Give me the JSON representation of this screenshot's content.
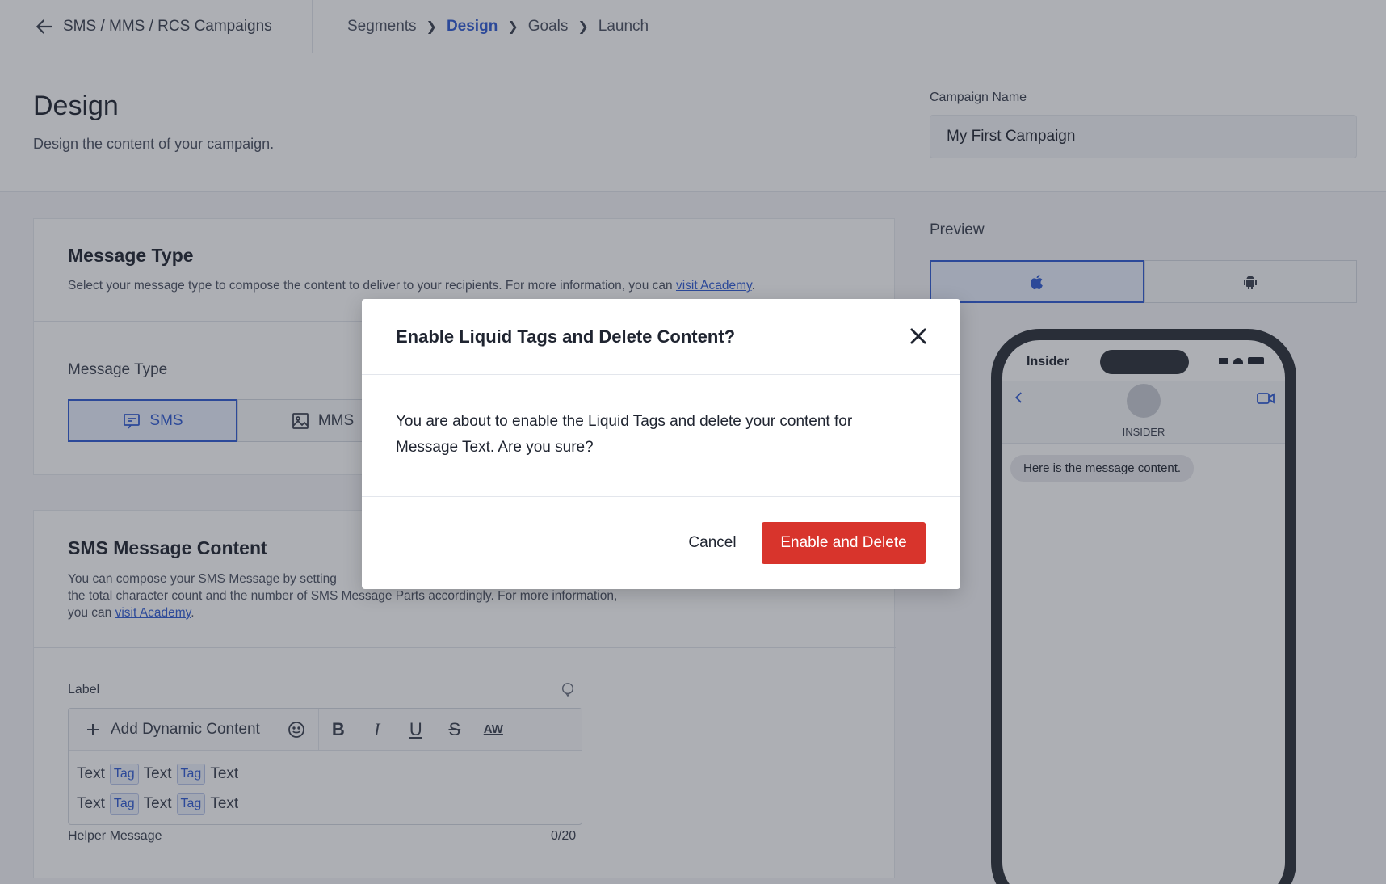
{
  "topbar": {
    "back_label": "SMS / MMS / RCS Campaigns",
    "breadcrumbs": [
      "Segments",
      "Design",
      "Goals",
      "Launch"
    ],
    "active_step": "Design"
  },
  "header": {
    "title": "Design",
    "subtitle": "Design the content of your campaign.",
    "campaign_name_label": "Campaign Name",
    "campaign_name_value": "My First Campaign"
  },
  "message_type_card": {
    "title": "Message Type",
    "desc_prefix": "Select your message type to compose the content to deliver to your recipients. For more information, you can ",
    "desc_link": "visit Academy",
    "desc_suffix": ".",
    "field_label": "Message Type",
    "options": [
      "SMS",
      "MMS"
    ],
    "selected": "SMS"
  },
  "sms_content_card": {
    "title": "SMS Message Content",
    "desc_line1": "You can compose your SMS Message by setting",
    "desc_line2": "the total character count and the number of SMS Message Parts accordingly. For more information,",
    "desc_line3_prefix": "you can ",
    "desc_link": "visit Academy",
    "desc_suffix": ".",
    "editor_label": "Label",
    "add_dynamic": "Add Dynamic Content",
    "tools": [
      "emoji-icon",
      "bold-icon",
      "italic-icon",
      "underline-icon",
      "strikethrough-icon",
      "spellcheck-icon"
    ],
    "line_words": [
      "Text",
      "Tag",
      "Text",
      "Tag",
      "Text"
    ],
    "helper": "Helper Message",
    "counter": "0/20"
  },
  "preview": {
    "label": "Preview",
    "os_options": [
      "apple-icon",
      "android-icon"
    ],
    "selected_os": "apple-icon",
    "carrier": "Insider",
    "sender": "INSIDER",
    "message": "Here is the message content."
  },
  "modal": {
    "title": "Enable Liquid Tags and Delete Content?",
    "body": "You are about to enable the Liquid Tags and delete your content for Message Text. Are you sure?",
    "cancel": "Cancel",
    "confirm": "Enable and Delete"
  },
  "colors": {
    "accent": "#2f5bd3",
    "danger": "#d8342c"
  }
}
